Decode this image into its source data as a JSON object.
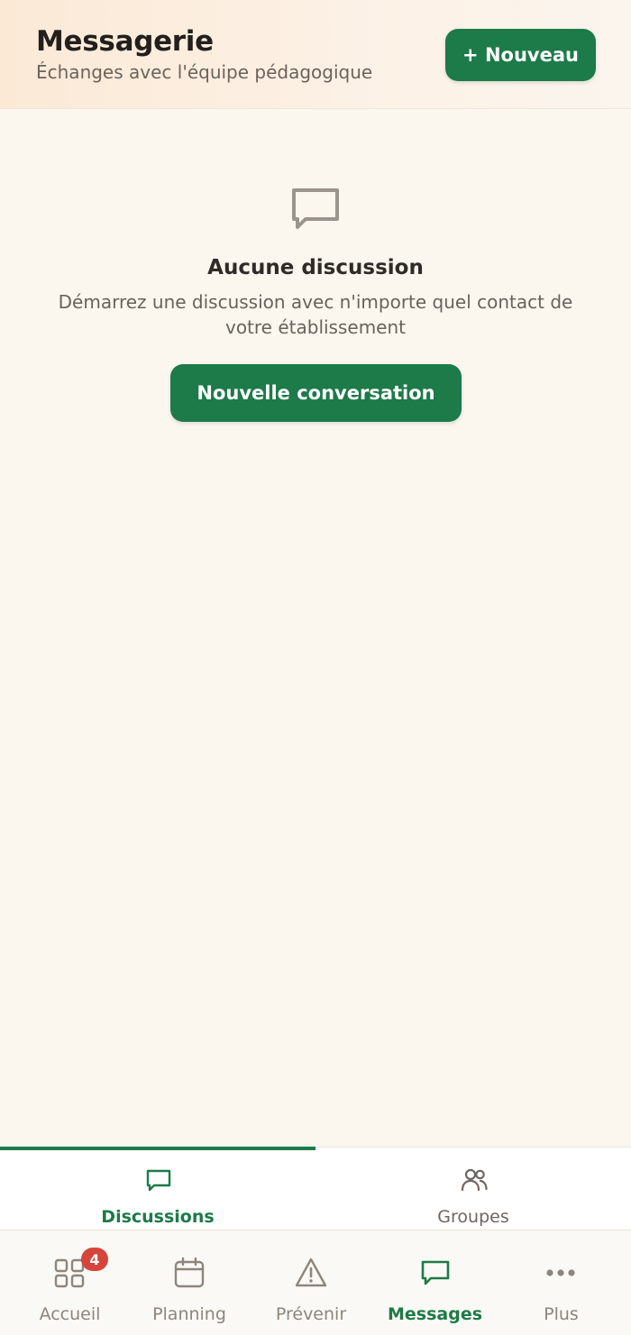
{
  "header": {
    "title": "Messagerie",
    "subtitle": "Échanges avec l'équipe pédagogique",
    "new_button": "+ Nouveau"
  },
  "empty_state": {
    "icon": "chat-bubble-icon",
    "title": "Aucune discussion",
    "text": "Démarrez une discussion avec n'importe quel contact de votre établissement",
    "button": "Nouvelle conversation"
  },
  "subtabs": [
    {
      "label": "Discussions",
      "icon": "chat-bubble-icon",
      "active": true
    },
    {
      "label": "Groupes",
      "icon": "users-icon",
      "active": false
    }
  ],
  "bottom_nav": [
    {
      "label": "Accueil",
      "icon": "grid-icon",
      "badge": "4"
    },
    {
      "label": "Planning",
      "icon": "calendar-icon"
    },
    {
      "label": "Prévenir",
      "icon": "warning-icon"
    },
    {
      "label": "Messages",
      "icon": "chat-bubble-icon",
      "active": true
    },
    {
      "label": "Plus",
      "icon": "more-dots-icon"
    }
  ],
  "colors": {
    "accent": "#1d7a49",
    "background": "#fbf7ef",
    "badge": "#d6453a"
  }
}
